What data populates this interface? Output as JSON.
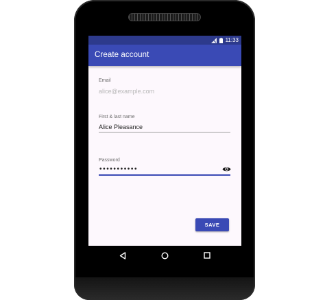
{
  "status_bar": {
    "time": "11:33",
    "icons": [
      "signal-off-icon",
      "battery-icon"
    ]
  },
  "app_bar": {
    "title": "Create account"
  },
  "form": {
    "email": {
      "label": "Email",
      "value": "",
      "placeholder": "alice@example.com"
    },
    "name": {
      "label": "First & last name",
      "value": "Alice Pleasance"
    },
    "password": {
      "label": "Password",
      "masked_value": "•••••••••••",
      "toggle_icon": "eye-icon"
    },
    "save_label": "SAVE"
  },
  "navigation": {
    "buttons": [
      "back-icon",
      "home-icon",
      "recents-icon"
    ]
  },
  "colors": {
    "status_bar": "#2d3a8c",
    "app_bar": "#3a4ab5",
    "accent": "#3a4ab5",
    "screen_bg": "#fdf8fd"
  }
}
